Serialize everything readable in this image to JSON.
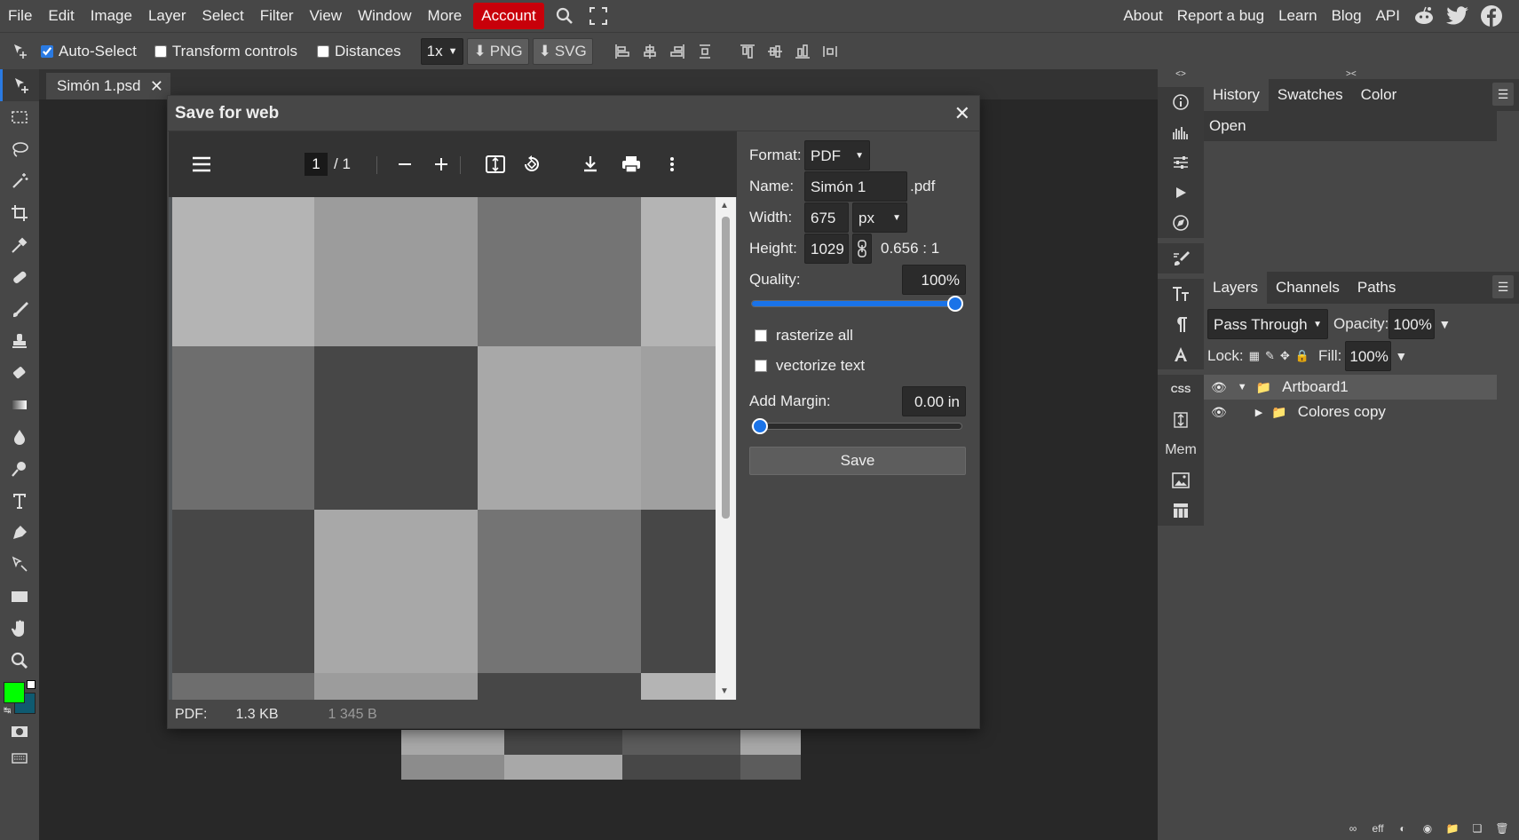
{
  "menu": {
    "items": [
      "File",
      "Edit",
      "Image",
      "Layer",
      "Select",
      "Filter",
      "View",
      "Window",
      "More"
    ],
    "account": "Account",
    "right_items": [
      "About",
      "Report a bug",
      "Learn",
      "Blog",
      "API"
    ]
  },
  "options": {
    "auto_select": "Auto-Select",
    "transform_controls": "Transform controls",
    "distances": "Distances",
    "zoom": "1x",
    "png": "PNG",
    "svg": "SVG"
  },
  "document_tab": {
    "title": "Simón 1.psd"
  },
  "dialog": {
    "title": "Save for web",
    "pdf_viewer": {
      "page_current": "1",
      "page_total": "/  1"
    },
    "settings": {
      "format_label": "Format:",
      "format_value": "PDF",
      "name_label": "Name:",
      "name_value": "Simón 1",
      "name_ext": ".pdf",
      "width_label": "Width:",
      "width_value": "675",
      "unit_value": "px",
      "height_label": "Height:",
      "height_value": "1029",
      "ratio": "0.656 : 1",
      "quality_label": "Quality:",
      "quality_value": "100%",
      "quality_level": 1.0,
      "rasterize_all": "rasterize all",
      "vectorize_text": "vectorize text",
      "margin_label": "Add Margin:",
      "margin_value": "0.00 in",
      "margin_level": 0.0,
      "save_button": "Save"
    },
    "footer": {
      "format": "PDF:",
      "size": "1.3 KB",
      "bytes": "1 345 B"
    }
  },
  "right_strip": {
    "mem_label": "Mem",
    "css_label": "CSS"
  },
  "panels": {
    "top_tabs": [
      "History",
      "Swatches",
      "Color"
    ],
    "history_items": [
      "Open"
    ],
    "layer_tabs": [
      "Layers",
      "Channels",
      "Paths"
    ],
    "blend_mode": "Pass Through",
    "opacity_label": "Opacity:",
    "opacity_value": "100%",
    "lock_label": "Lock:",
    "fill_label": "Fill:",
    "fill_value": "100%",
    "layers": [
      {
        "name": "Artboard1"
      },
      {
        "name": "Colores copy"
      }
    ]
  },
  "colors": {
    "foreground": "#00ff00",
    "background": "#0f5a70",
    "accent": "#1a73e8",
    "account_bg": "#c8000a"
  }
}
